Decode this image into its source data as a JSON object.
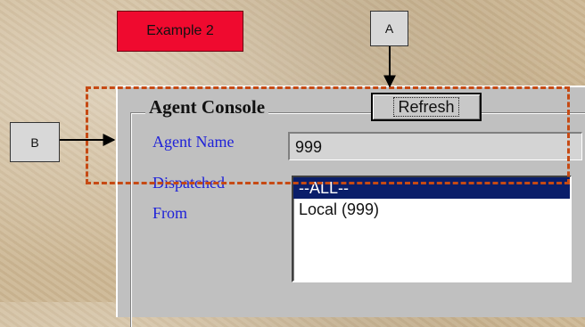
{
  "example_label": "Example 2",
  "callouts": {
    "a": "A",
    "b": "B"
  },
  "panel": {
    "title": "Agent Console",
    "refresh_label": "Refresh",
    "agent_name_label": "Agent Name",
    "agent_name_value": "999",
    "dispatched_label": "Dispatched",
    "from_label": "From",
    "dispatch_options": [
      "--ALL--",
      "Local (999)"
    ],
    "selected_option": "--ALL--"
  },
  "colors": {
    "example_bg": "#ef0a2f",
    "label_text": "#1f22d8",
    "highlight_dash": "#c64a14",
    "selection_bg": "#0a1e6a"
  }
}
